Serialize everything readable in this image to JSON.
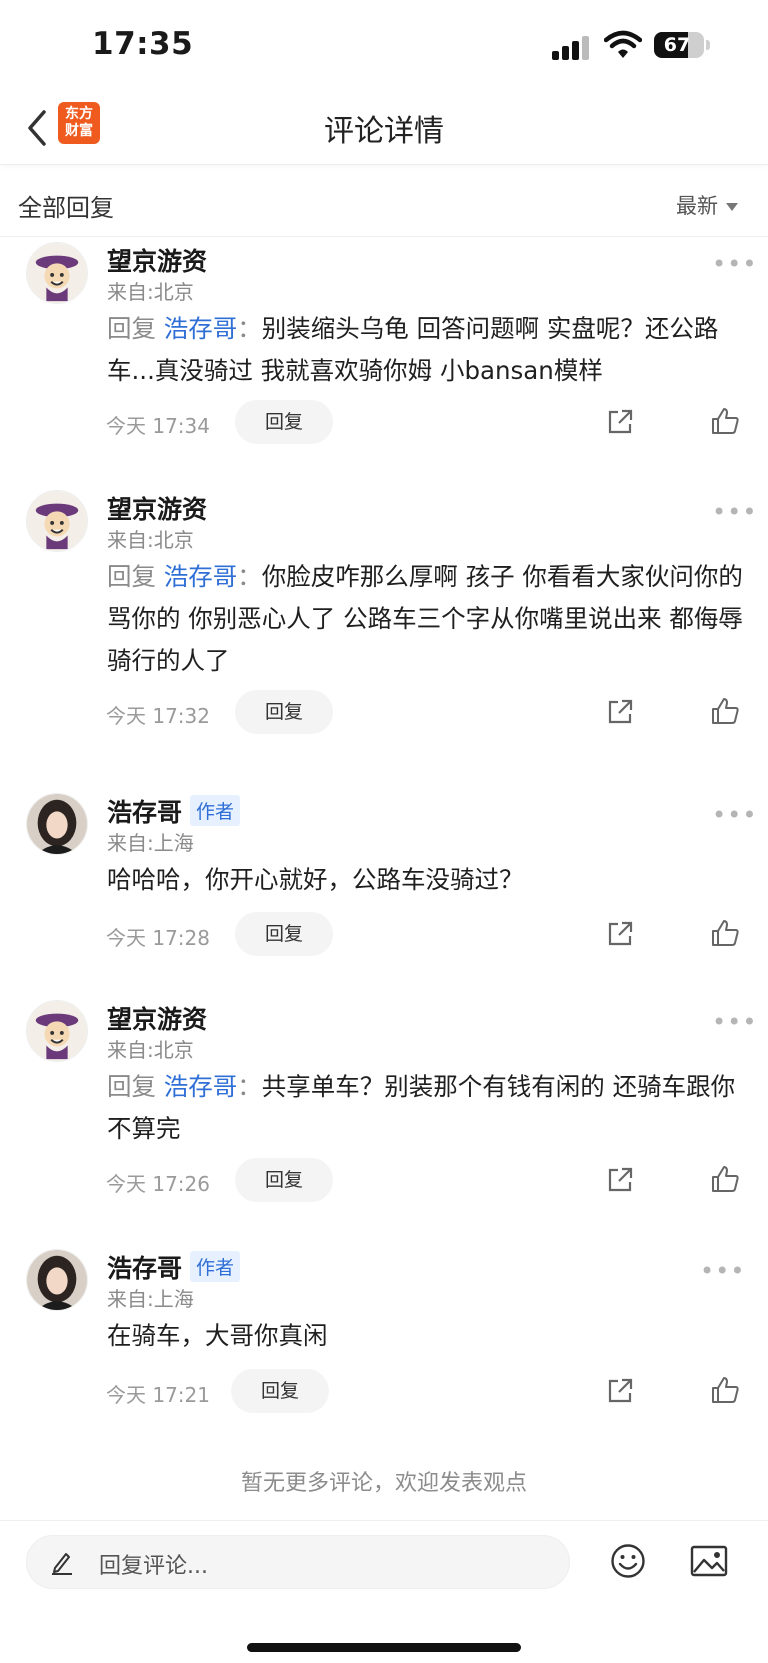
{
  "status_bar": {
    "time": "17:35",
    "battery": "67"
  },
  "nav": {
    "title": "评论详情",
    "logo_line1": "东方",
    "logo_line2": "财富"
  },
  "section": {
    "title": "全部回复",
    "sort_label": "最新"
  },
  "reply_word": "回复",
  "reply_button_label": "回复",
  "author_tag": "作者",
  "comments": [
    {
      "user": "望京游资",
      "location": "来自:北京",
      "reply_to": "浩存哥",
      "text": "别装缩头乌龟 回答问题啊 实盘呢？还公路车...真没骑过 我就喜欢骑你姆 小bansan模样",
      "time": "今天 17:34"
    },
    {
      "user": "望京游资",
      "location": "来自:北京",
      "reply_to": "浩存哥",
      "text": "你脸皮咋那么厚啊 孩子 你看看大家伙问你的 骂你的 你别恶心人了 公路车三个字从你嘴里说出来 都侮辱骑行的人了",
      "time": "今天 17:32"
    },
    {
      "user": "浩存哥",
      "location": "来自:上海",
      "text": "哈哈哈，你开心就好，公路车没骑过？",
      "time": "今天 17:28"
    },
    {
      "user": "望京游资",
      "location": "来自:北京",
      "reply_to": "浩存哥",
      "text": "共享单车？别装那个有钱有闲的 还骑车跟你不算完",
      "time": "今天 17:26"
    },
    {
      "user": "浩存哥",
      "location": "来自:上海",
      "text": "在骑车，大哥你真闲",
      "time": "今天 17:21"
    }
  ],
  "footer_note": "暂无更多评论，欢迎发表观点",
  "input": {
    "placeholder": "回复评论..."
  }
}
